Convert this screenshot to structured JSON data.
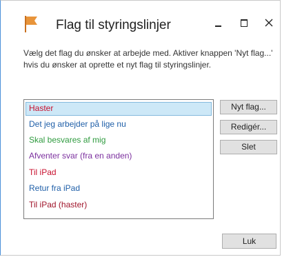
{
  "window": {
    "title": "Flag til styringslinjer",
    "flag_color": "#e8943a"
  },
  "description": "Vælg det flag du ønsker at arbejde med. Aktiver knappen 'Nyt flag...' hvis du ønsker at oprette et nyt flag til styringslinjer.",
  "flags": [
    {
      "label": "Haster",
      "color": "#c8102e",
      "selected": true
    },
    {
      "label": "Det jeg arbejder på lige nu",
      "color": "#1f5fa8",
      "selected": false
    },
    {
      "label": "Skal besvares af mig",
      "color": "#2e9a3e",
      "selected": false
    },
    {
      "label": "Afventer svar (fra en anden)",
      "color": "#7b2f9e",
      "selected": false
    },
    {
      "label": "Til iPad",
      "color": "#c8102e",
      "selected": false
    },
    {
      "label": "Retur fra iPad",
      "color": "#1f5fa8",
      "selected": false
    },
    {
      "label": "Til iPad (haster)",
      "color": "#a0142a",
      "selected": false
    }
  ],
  "buttons": {
    "new_flag": "Nyt flag...",
    "edit": "Redigér...",
    "delete": "Slet",
    "close": "Luk"
  },
  "icons": {
    "flag": "flag-icon",
    "minimize": "minimize-icon",
    "maximize": "maximize-icon",
    "close": "close-icon"
  }
}
